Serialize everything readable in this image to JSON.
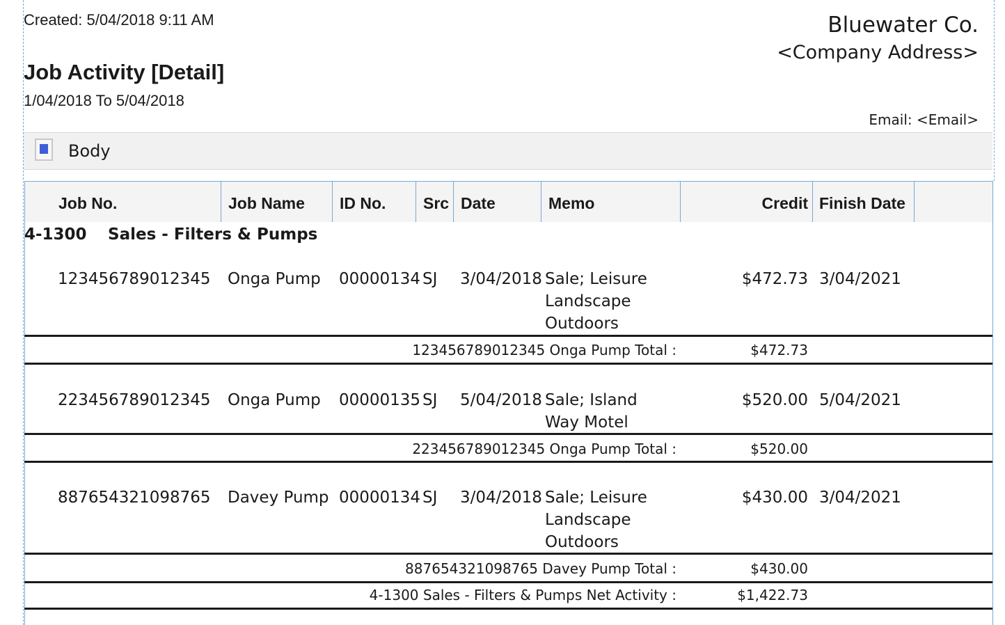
{
  "report": {
    "created": "Created: 5/04/2018 9:11 AM",
    "title": "Job Activity [Detail]",
    "date_range": "1/04/2018 To 5/04/2018",
    "company_name": "Bluewater Co.",
    "company_address": "<Company Address>",
    "email": "Email: <Email>"
  },
  "band": {
    "label": "Body",
    "icon": "section-icon"
  },
  "columns": [
    "Job No.",
    "Job Name",
    "ID No.",
    "Src",
    "Date",
    "Memo",
    "Credit",
    "Finish Date"
  ],
  "group": {
    "account": "4-1300",
    "name": "Sales - Filters & Pumps"
  },
  "jobs": [
    {
      "job_no": "123456789012345",
      "job_name": "Onga Pump",
      "id_no": "00000134",
      "src": "SJ",
      "date": "3/04/2018",
      "memo": "Sale; Leisure Landscape Outdoors",
      "credit": "$472.73",
      "finish_date": "3/04/2021",
      "total_label": "123456789012345 Onga Pump  Total :",
      "total": "$472.73"
    },
    {
      "job_no": "223456789012345",
      "job_name": "Onga Pump",
      "id_no": "00000135",
      "src": "SJ",
      "date": "5/04/2018",
      "memo": "Sale; Island Way Motel",
      "credit": "$520.00",
      "finish_date": "5/04/2021",
      "total_label": "223456789012345 Onga Pump  Total :",
      "total": "$520.00"
    },
    {
      "job_no": "887654321098765",
      "job_name": "Davey Pump",
      "id_no": "00000134",
      "src": "SJ",
      "date": "3/04/2018",
      "memo": "Sale; Leisure Landscape Outdoors",
      "credit": "$430.00",
      "finish_date": "3/04/2021",
      "total_label": "887654321098765 Davey Pump  Total :",
      "total": "$430.00"
    }
  ],
  "net_activity": {
    "label": "4-1300 Sales - Filters & Pumps  Net Activity :",
    "value": "$1,422.73"
  }
}
